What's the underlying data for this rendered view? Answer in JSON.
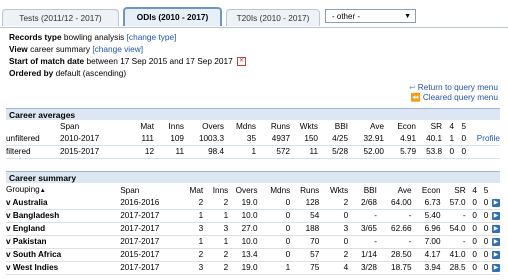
{
  "tabs": [
    {
      "label": "Tests (2011/12 - 2017)",
      "active": false
    },
    {
      "label": "ODIs (2010 - 2017)",
      "active": true
    },
    {
      "label": "T20Is (2010 - 2017)",
      "active": false
    }
  ],
  "other_select": {
    "value": "- other -"
  },
  "info": {
    "records_type_label": "Records type",
    "records_type_value": "bowling analysis",
    "change_type": "[change type]",
    "view_label": "View",
    "view_value": "career summary",
    "change_view": "[change view]",
    "start_label": "Start of match date",
    "start_value": "between 17 Sep 2015 and 17 Sep 2017",
    "ordered_label": "Ordered by",
    "ordered_value": "default (ascending)"
  },
  "links": {
    "return": "Return to query menu",
    "cleared": "Cleared query menu"
  },
  "career_averages": {
    "title": "Career averages",
    "headers": [
      "Span",
      "Mat",
      "Inns",
      "Overs",
      "Mdns",
      "Runs",
      "Wkts",
      "BBI",
      "Ave",
      "Econ",
      "SR",
      "4",
      "5"
    ],
    "rows": [
      {
        "label": "unfiltered",
        "cells": [
          "2010-2017",
          "111",
          "109",
          "1003.3",
          "35",
          "4937",
          "150",
          "4/25",
          "32.91",
          "4.91",
          "40.1",
          "1",
          "0"
        ],
        "extra": "Profile"
      },
      {
        "label": "filtered",
        "cells": [
          "2015-2017",
          "12",
          "11",
          "98.4",
          "1",
          "572",
          "11",
          "5/28",
          "52.00",
          "5.79",
          "53.8",
          "0",
          "0"
        ],
        "extra": ""
      }
    ]
  },
  "career_summary": {
    "title": "Career summary",
    "grouping_label": "Grouping",
    "headers": [
      "Span",
      "Mat",
      "Inns",
      "Overs",
      "Mdns",
      "Runs",
      "Wkts",
      "BBI",
      "Ave",
      "Econ",
      "SR",
      "4",
      "5"
    ],
    "rows": [
      {
        "label": "v Australia",
        "cells": [
          "2016-2016",
          "2",
          "2",
          "19.0",
          "0",
          "128",
          "2",
          "2/68",
          "64.00",
          "6.73",
          "57.0",
          "0",
          "0"
        ]
      },
      {
        "label": "v Bangladesh",
        "cells": [
          "2017-2017",
          "1",
          "1",
          "10.0",
          "0",
          "54",
          "0",
          "-",
          "-",
          "5.40",
          "-",
          "0",
          "0"
        ]
      },
      {
        "label": "v England",
        "cells": [
          "2017-2017",
          "3",
          "3",
          "27.0",
          "0",
          "188",
          "3",
          "3/65",
          "62.66",
          "6.96",
          "54.0",
          "0",
          "0"
        ]
      },
      {
        "label": "v Pakistan",
        "cells": [
          "2017-2017",
          "1",
          "1",
          "10.0",
          "0",
          "70",
          "0",
          "-",
          "-",
          "7.00",
          "-",
          "0",
          "0"
        ]
      },
      {
        "label": "v South Africa",
        "cells": [
          "2015-2017",
          "2",
          "2",
          "13.4",
          "0",
          "57",
          "2",
          "1/14",
          "28.50",
          "4.17",
          "41.0",
          "0",
          "0"
        ]
      },
      {
        "label": "v West Indies",
        "cells": [
          "2017-2017",
          "3",
          "2",
          "19.0",
          "1",
          "75",
          "4",
          "3/28",
          "18.75",
          "3.94",
          "28.5",
          "0",
          "0"
        ]
      }
    ]
  }
}
